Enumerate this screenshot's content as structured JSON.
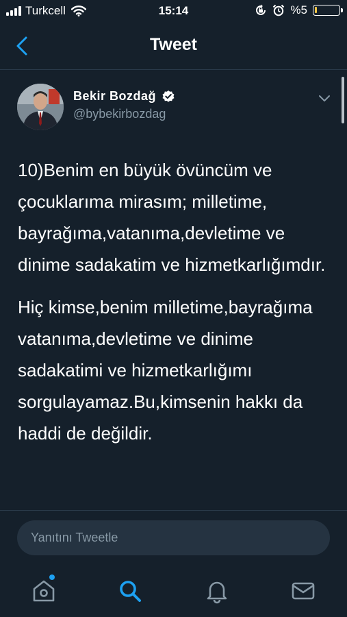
{
  "status_bar": {
    "carrier": "Turkcell",
    "time": "15:14",
    "battery_text": "%5",
    "battery_level": 0.05,
    "icons": [
      "signal-icon",
      "wifi-icon",
      "rotation-lock-icon",
      "alarm-icon",
      "battery-icon"
    ]
  },
  "nav": {
    "title": "Tweet",
    "back_icon": "back-chevron-icon"
  },
  "tweet": {
    "author_name": "Bekir  Bozdağ",
    "handle": "@bybekirbozdag",
    "verified": true,
    "paragraphs": [
      "10)Benim en büyük övüncüm ve çocuklarıma mirasım; milletime, bayrağıma,vatanıma,devletime ve dinime sadakatim ve hizmetkarlığımdır.",
      "Hiç kimse,benim milletime,bayrağıma vatanıma,devletime ve dinime sadakatimi ve hizmetkarlığımı sorgulayamaz.Bu,kimsenin hakkı da haddi de değildir."
    ]
  },
  "reply": {
    "placeholder": "Yanıtını Tweetle"
  },
  "tabs": [
    {
      "icon": "home-icon",
      "has_notification_dot": true
    },
    {
      "icon": "search-icon",
      "active": true
    },
    {
      "icon": "notifications-bell-icon"
    },
    {
      "icon": "messages-envelope-icon"
    }
  ],
  "colors": {
    "background": "#15202b",
    "accent": "#1da1f2",
    "secondary_text": "#8899a6",
    "reply_field": "#253341"
  }
}
